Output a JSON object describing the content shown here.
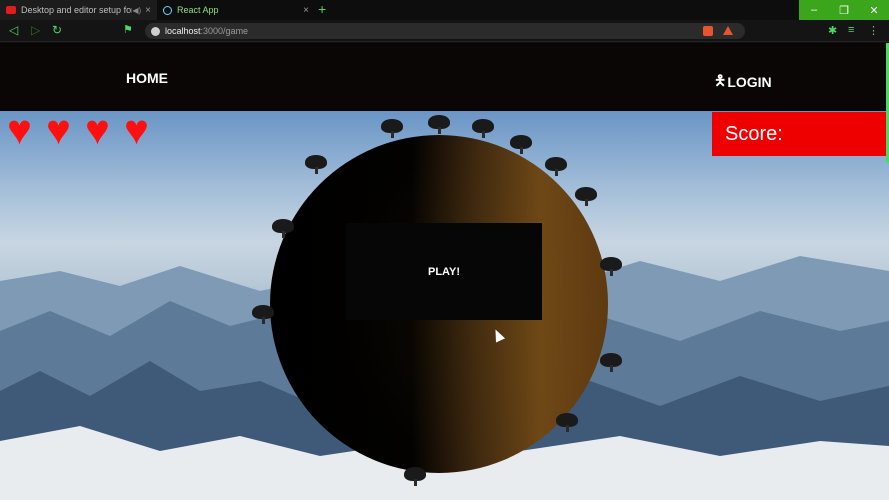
{
  "browser": {
    "tabs": [
      {
        "title": "Desktop and editor setup for Rus",
        "icon": "youtube-icon"
      },
      {
        "title": "React App",
        "icon": "react-icon"
      }
    ],
    "tab_close": "×",
    "new_tab": "+",
    "window_controls": {
      "minimize": "–",
      "restore": "❐",
      "close": "✕"
    },
    "url_host": "localhost",
    "url_path": ":3000/game",
    "accent": "#4cd964"
  },
  "nav": {
    "home": "HOME",
    "login": "LOGIN",
    "login_icon": "person-icon"
  },
  "game": {
    "lives": 4,
    "heart_color": "#ff1010",
    "score_label": "Score:",
    "play_label": "PLAY!",
    "score_bg": "#ee0000"
  }
}
